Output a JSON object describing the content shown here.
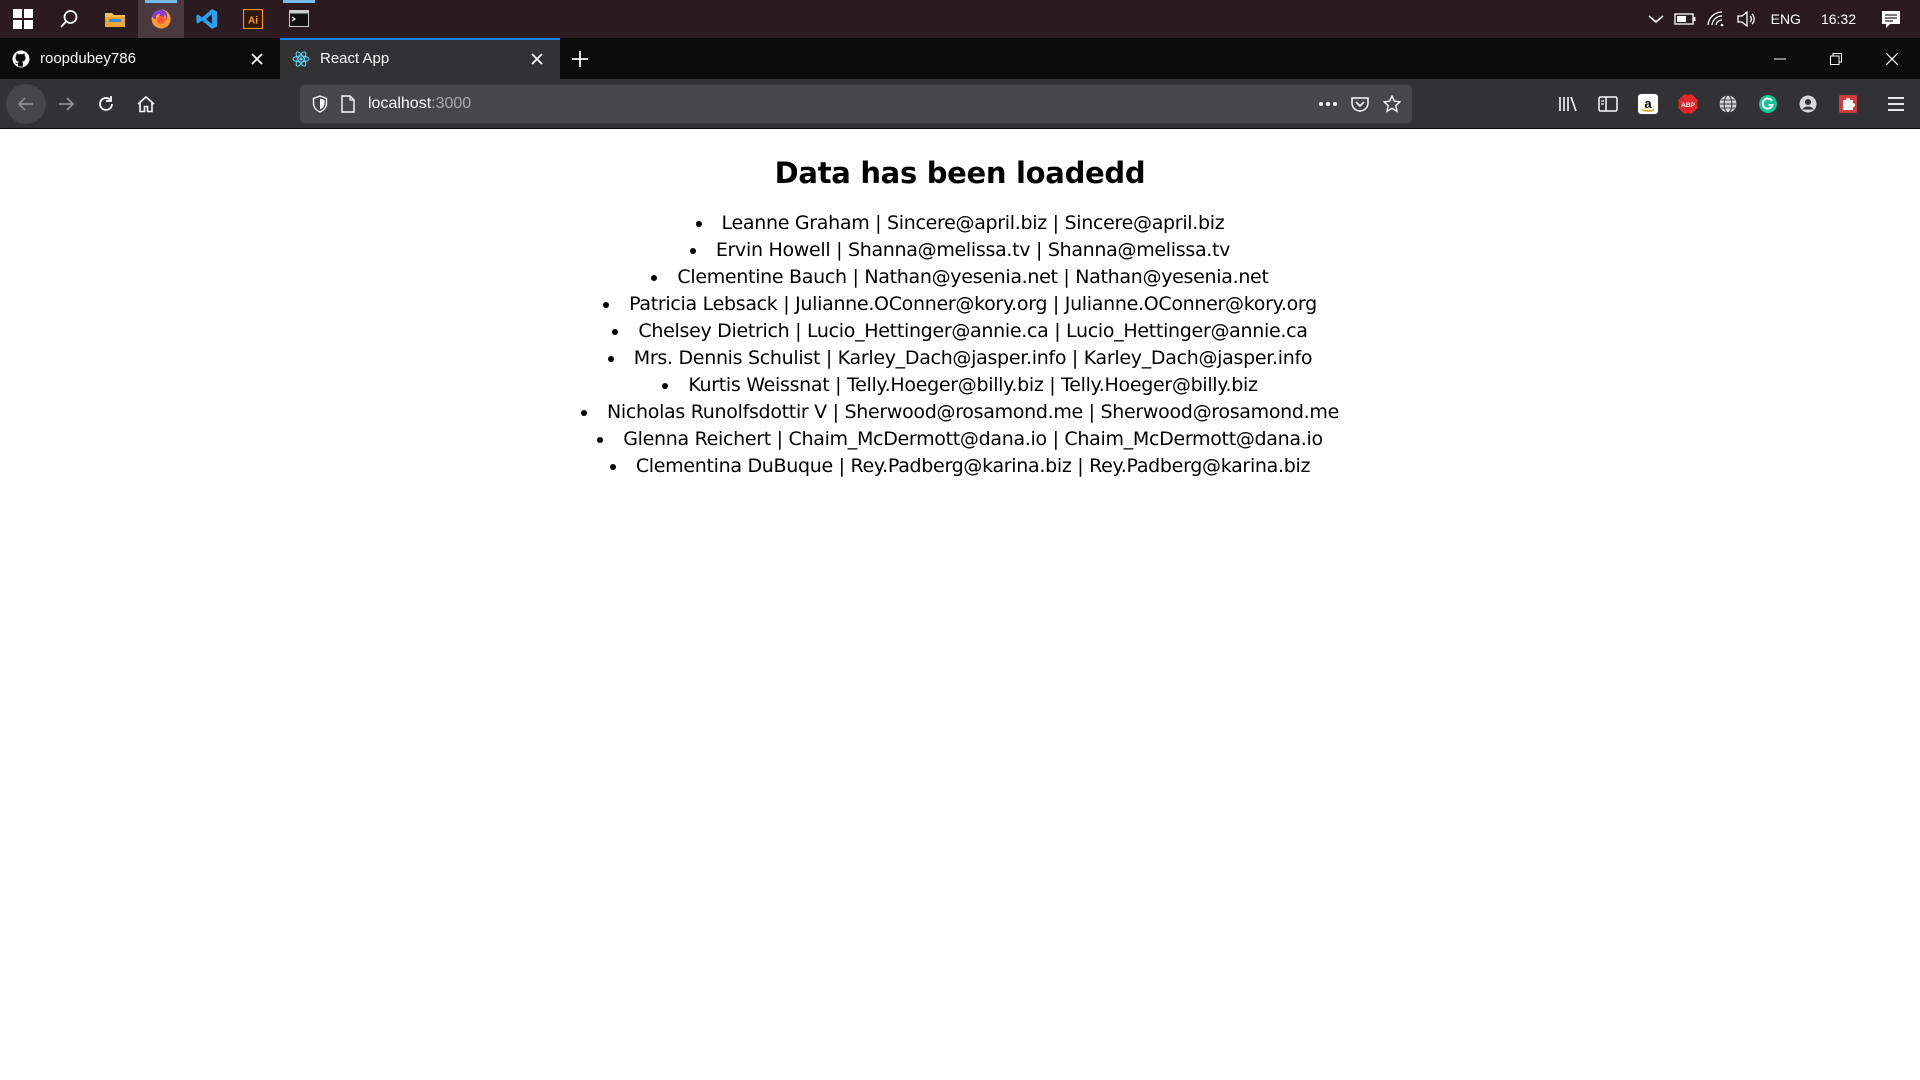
{
  "taskbar": {
    "language": "ENG",
    "time": "16:32"
  },
  "browser": {
    "tabs": [
      {
        "title": "roopdubey786",
        "favicon": "github-icon",
        "selected": false
      },
      {
        "title": "React App",
        "favicon": "react-icon",
        "selected": true
      }
    ],
    "url": {
      "host": "localhost",
      "port": ":3000"
    },
    "accent_color": "#0a84ff"
  },
  "page": {
    "heading": "Data has been loadedd",
    "users": [
      "Leanne Graham | Sincere@april.biz | Sincere@april.biz",
      "Ervin Howell | Shanna@melissa.tv | Shanna@melissa.tv",
      "Clementine Bauch | Nathan@yesenia.net | Nathan@yesenia.net",
      "Patricia Lebsack | Julianne.OConner@kory.org | Julianne.OConner@kory.org",
      "Chelsey Dietrich | Lucio_Hettinger@annie.ca | Lucio_Hettinger@annie.ca",
      "Mrs. Dennis Schulist | Karley_Dach@jasper.info | Karley_Dach@jasper.info",
      "Kurtis Weissnat | Telly.Hoeger@billy.biz | Telly.Hoeger@billy.biz",
      "Nicholas Runolfsdottir V | Sherwood@rosamond.me | Sherwood@rosamond.me",
      "Glenna Reichert | Chaim_McDermott@dana.io | Chaim_McDermott@dana.io",
      "Clementina DuBuque | Rey.Padberg@karina.biz | Rey.Padberg@karina.biz"
    ]
  }
}
